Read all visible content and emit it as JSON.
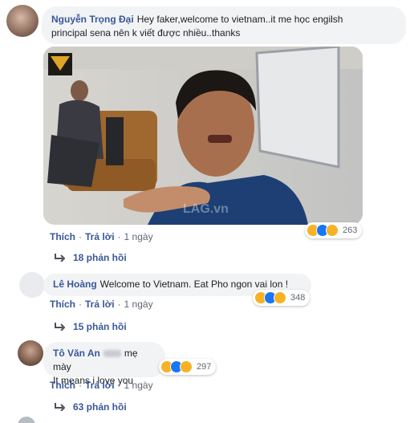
{
  "comments": [
    {
      "author": "Nguyễn Trọng Đại",
      "line1": "Hey faker,welcome to vietnam..it me học engilsh",
      "line2": "principal sena nên k viết được nhiều..thanks",
      "actions": {
        "like": "Thích",
        "reply": "Trả lời",
        "time": "1 ngày"
      },
      "reaction_count": "263",
      "replies": "18 phản hồi"
    },
    {
      "author": "Lê Hoàng",
      "text": "Welcome to Vietnam. Eat Pho ngon vai lon !",
      "actions": {
        "like": "Thích",
        "reply": "Trả lời",
        "time": "1 ngày"
      },
      "reaction_count": "348",
      "replies": "15 phản hồi"
    },
    {
      "author": "Tô Văn An",
      "text_inline": "mẹ mày",
      "line2": "It means i love you",
      "actions": {
        "like": "Thích",
        "reply": "Trả lời",
        "time": "1 ngày"
      },
      "reaction_count": "297",
      "replies": "63 phản hồi"
    }
  ],
  "video": {
    "watermark": "LAG.vn"
  },
  "colors": {
    "link": "#385898",
    "bubble": "#f2f3f5",
    "meta": "#606770"
  }
}
